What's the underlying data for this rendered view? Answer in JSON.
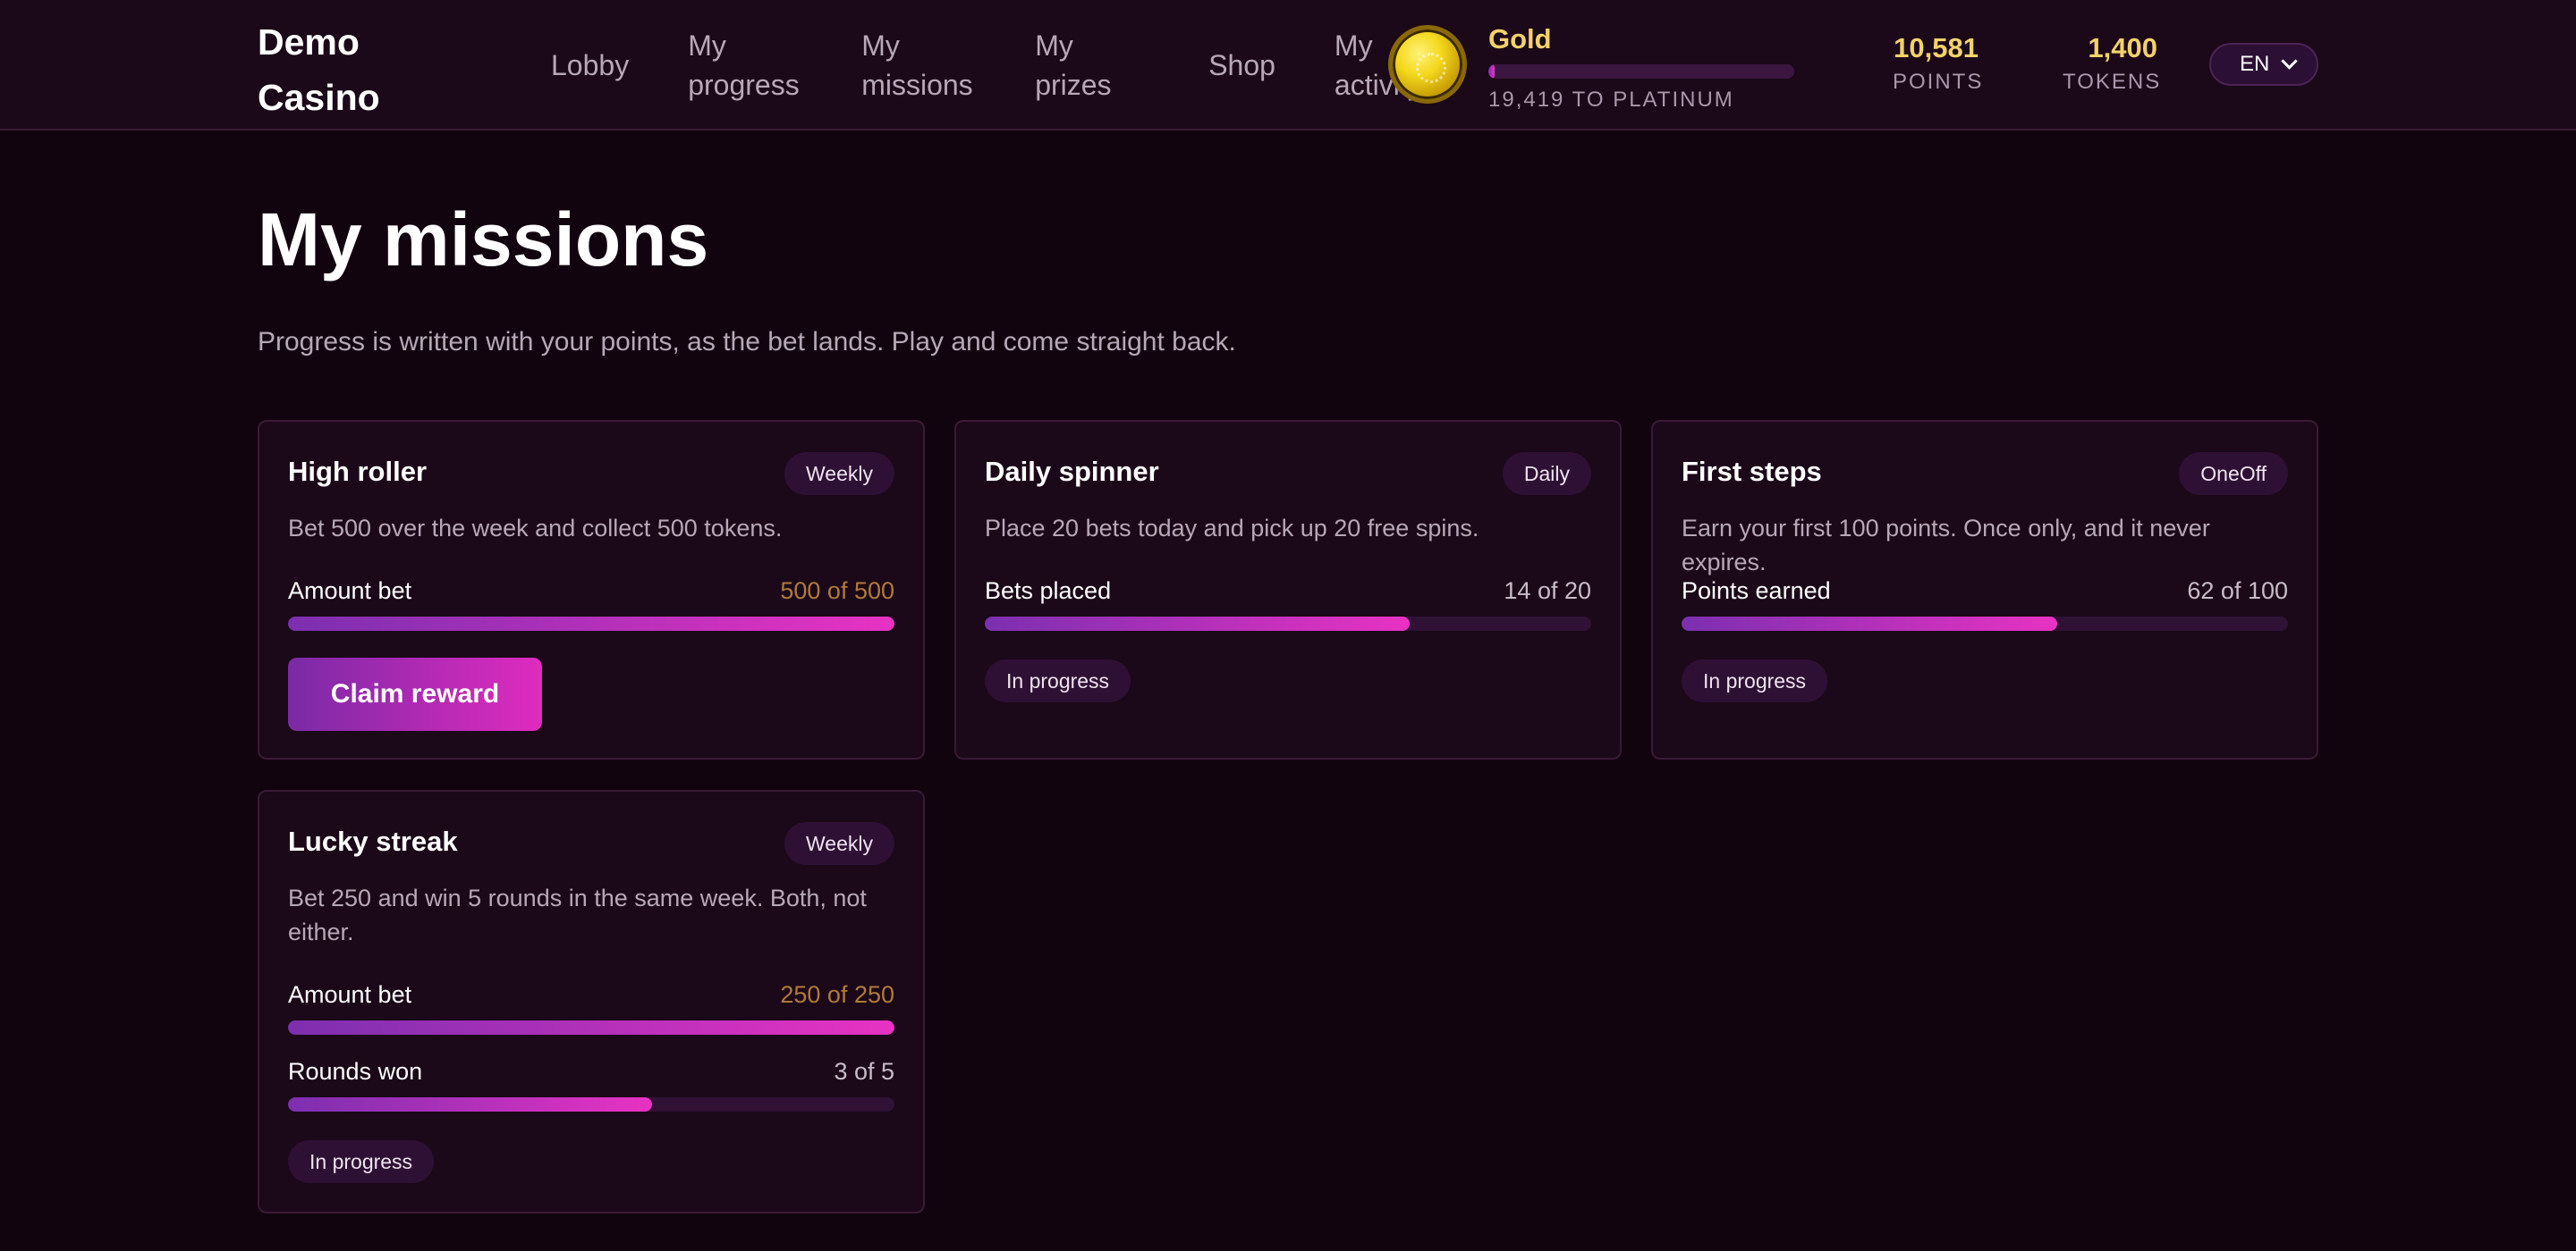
{
  "header": {
    "brand": "Demo Casino",
    "nav": [
      {
        "label": "Lobby"
      },
      {
        "label": "My progress"
      },
      {
        "label": "My missions"
      },
      {
        "label": "My prizes"
      },
      {
        "label": "Shop"
      },
      {
        "label": "My activity"
      }
    ],
    "tier": {
      "name": "Gold",
      "to_next": "19,419 TO PLATINUM",
      "progress_fraction": 0.02
    },
    "stats": {
      "points": {
        "value": "10,581",
        "label": "POINTS"
      },
      "tokens": {
        "value": "1,400",
        "label": "TOKENS"
      }
    },
    "language": "EN"
  },
  "page": {
    "title": "My missions",
    "subtitle": "Progress is written with your points, as the bet lands. Play and come straight back."
  },
  "missions": [
    {
      "title": "High roller",
      "badge": "Weekly",
      "description": "Bet 500 over the week and collect 500 tokens.",
      "metrics": [
        {
          "label": "Amount bet",
          "value": "500 of 500",
          "current": 500,
          "target": 500
        }
      ],
      "action": "Claim reward"
    },
    {
      "title": "Daily spinner",
      "badge": "Daily",
      "description": "Place 20 bets today and pick up 20 free spins.",
      "metrics": [
        {
          "label": "Bets placed",
          "value": "14 of 20",
          "current": 14,
          "target": 20
        }
      ],
      "status": "In progress"
    },
    {
      "title": "First steps",
      "badge": "OneOff",
      "description": "Earn your first 100 points. Once only, and it never expires.",
      "metrics": [
        {
          "label": "Points earned",
          "value": "62 of 100",
          "current": 62,
          "target": 100
        }
      ],
      "status": "In progress"
    },
    {
      "title": "Lucky streak",
      "badge": "Weekly",
      "description": "Bet 250 and win 5 rounds in the same week. Both, not either.",
      "metrics": [
        {
          "label": "Amount bet",
          "value": "250 of 250",
          "current": 250,
          "target": 250
        },
        {
          "label": "Rounds won",
          "value": "3 of 5",
          "current": 3,
          "target": 5
        }
      ],
      "status": "In progress"
    }
  ],
  "colors": {
    "accent_start": "#7c2fb0",
    "accent_end": "#e832c3",
    "gold": "#f3d26a",
    "background": "#12040f"
  },
  "icons": {
    "tier": "gold-coin-icon",
    "language": "chevron-down-icon"
  }
}
